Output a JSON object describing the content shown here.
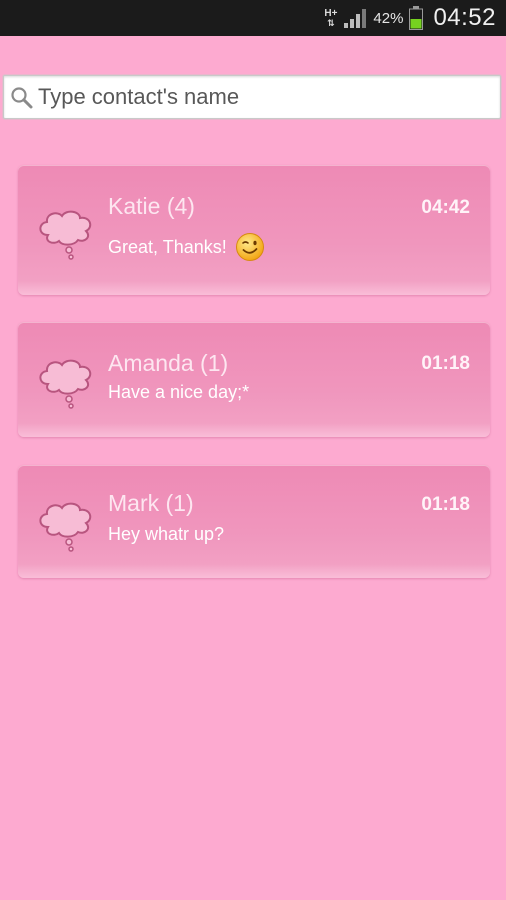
{
  "status_bar": {
    "network_type": "H+",
    "battery_percent": "42%",
    "time": "04:52",
    "icons": [
      "signal-icon",
      "battery-icon"
    ]
  },
  "search": {
    "placeholder": "Type contact's name",
    "value": ""
  },
  "conversations": [
    {
      "name": "Katie (4)",
      "time": "04:42",
      "snippet": "Great,  Thanks!",
      "emoji": "wink-emoji-icon"
    },
    {
      "name": "Amanda (1)",
      "time": "01:18",
      "snippet": "Have a nice day;*",
      "emoji": null
    },
    {
      "name": "Mark (1)",
      "time": "01:18",
      "snippet": "Hey whatr up?",
      "emoji": null
    }
  ],
  "colors": {
    "background": "#fdaad0",
    "card": "#ee8ab5",
    "status_bar": "#1b1b1b"
  }
}
